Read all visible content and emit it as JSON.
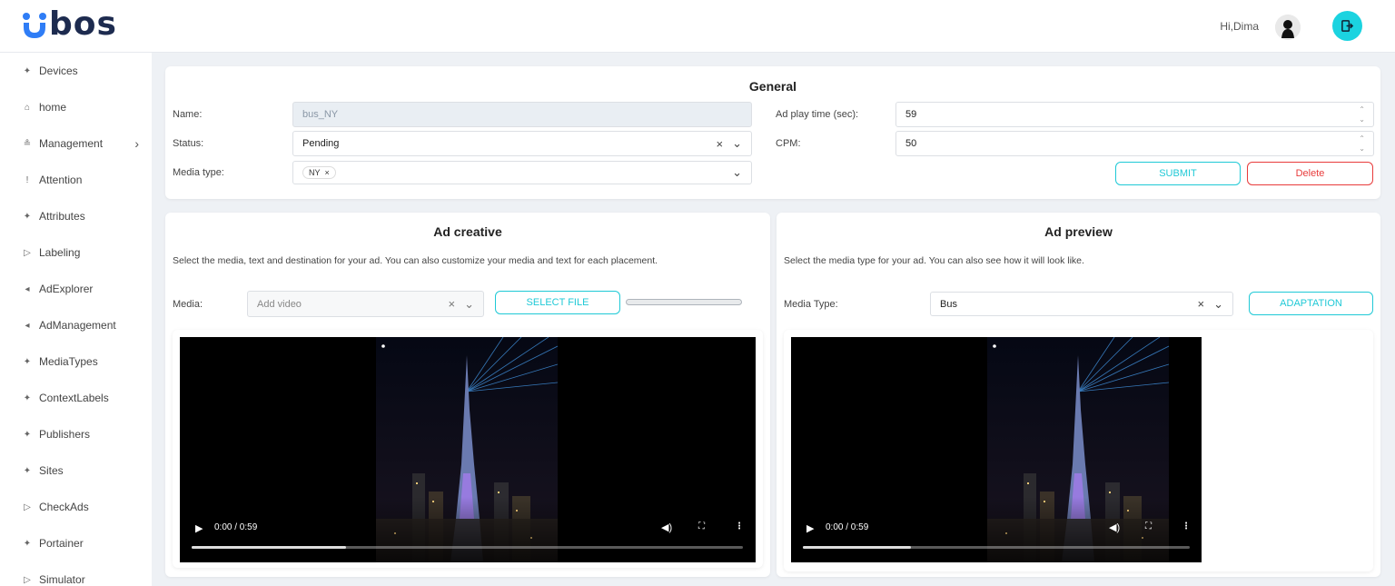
{
  "header": {
    "logo_text": "bos",
    "greeting": "Hi,Dima"
  },
  "sidebar": {
    "items": [
      {
        "label": "Devices",
        "icon": "sparkle-icon"
      },
      {
        "label": "home",
        "icon": "home-icon"
      },
      {
        "label": "Management",
        "icon": "users-icon",
        "has_children": true
      },
      {
        "label": "Attention",
        "icon": "exclamation-icon"
      },
      {
        "label": "Attributes",
        "icon": "sparkle-icon"
      },
      {
        "label": "Labeling",
        "icon": "tag-icon"
      },
      {
        "label": "AdExplorer",
        "icon": "megaphone-icon"
      },
      {
        "label": "AdManagement",
        "icon": "megaphone-icon"
      },
      {
        "label": "MediaTypes",
        "icon": "sparkle-icon"
      },
      {
        "label": "ContextLabels",
        "icon": "sparkle-icon"
      },
      {
        "label": "Publishers",
        "icon": "sparkle-icon"
      },
      {
        "label": "Sites",
        "icon": "sparkle-icon"
      },
      {
        "label": "CheckAds",
        "icon": "tag-icon"
      },
      {
        "label": "Portainer",
        "icon": "sparkle-icon"
      },
      {
        "label": "Simulator",
        "icon": "tag-icon"
      }
    ]
  },
  "general": {
    "title": "General",
    "name_label": "Name:",
    "name_value": "bus_NY",
    "status_label": "Status:",
    "status_value": "Pending",
    "media_type_label": "Media type:",
    "media_type_chip": "NY",
    "play_time_label": "Ad play time (sec):",
    "play_time_value": "59",
    "cpm_label": "CPM:",
    "cpm_value": "50",
    "submit_label": "SUBMIT",
    "delete_label": "Delete"
  },
  "ad_creative": {
    "title": "Ad creative",
    "description": "Select the media, text and destination for your ad. You can also customize your media and text for each placement.",
    "media_label": "Media:",
    "media_placeholder": "Add video",
    "select_file_label": "SELECT FILE",
    "upload_progress": 0,
    "video_time": "0:00 / 0:59",
    "video_progress": 0.28
  },
  "ad_preview": {
    "title": "Ad preview",
    "description": "Select the media type for your ad. You can also see how it will look like.",
    "media_type_label": "Media Type:",
    "media_type_value": "Bus",
    "adaptation_label": "ADAPTATION",
    "video_time": "0:00 / 0:59",
    "video_progress": 0.28
  },
  "colors": {
    "accent": "#1bd3e0",
    "danger": "#e83b3b",
    "brand": "#1d2b4f",
    "logo_blue": "#2f7df6"
  }
}
